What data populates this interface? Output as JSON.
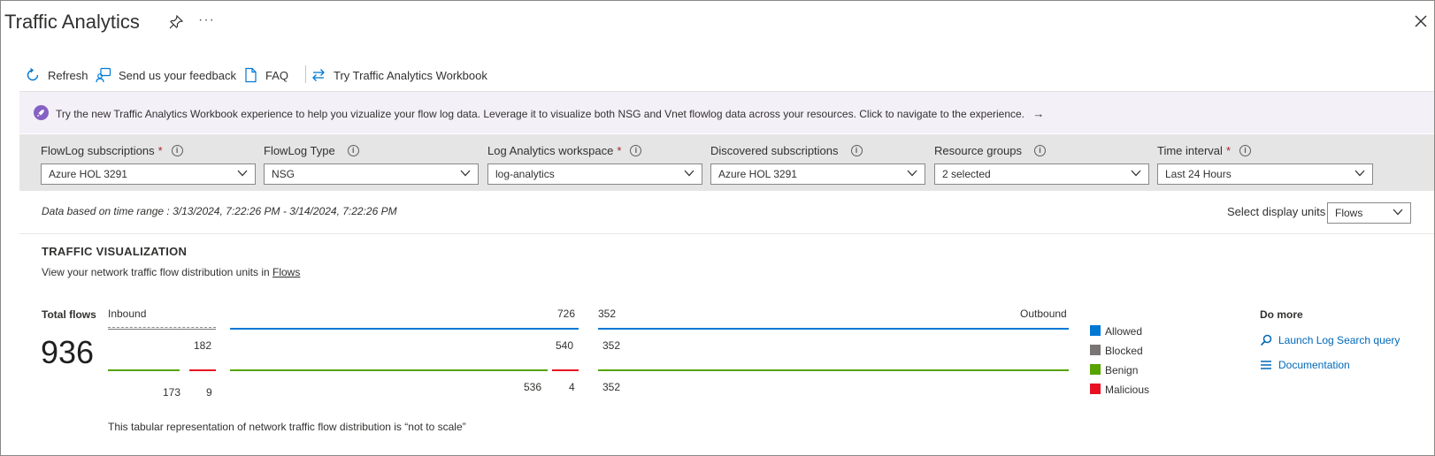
{
  "header": {
    "title": "Traffic Analytics",
    "more": "···"
  },
  "toolbar": {
    "refresh": "Refresh",
    "feedback": "Send us your feedback",
    "faq": "FAQ",
    "workbook": "Try Traffic Analytics Workbook"
  },
  "banner": {
    "text": "Try the new Traffic Analytics Workbook experience to help you vizualize your flow log data. Leverage it to visualize both NSG and Vnet flowlog data across your resources. Click to navigate to the experience.",
    "arrow": "→"
  },
  "filters": [
    {
      "label": "FlowLog subscriptions",
      "required": "*",
      "value": "Azure HOL 3291"
    },
    {
      "label": "FlowLog Type",
      "required": "",
      "value": "NSG"
    },
    {
      "label": "Log Analytics workspace",
      "required": "*",
      "value": "log-analytics"
    },
    {
      "label": "Discovered subscriptions",
      "required": "",
      "value": "Azure HOL 3291"
    },
    {
      "label": "Resource groups",
      "required": "",
      "value": "2 selected"
    },
    {
      "label": "Time interval",
      "required": "*",
      "value": "Last 24 Hours"
    }
  ],
  "time_range": "Data based on time range : 3/13/2024, 7:22:26 PM - 3/14/2024, 7:22:26 PM",
  "display_units": {
    "label": "Select display units",
    "value": "Flows"
  },
  "visualization": {
    "title": "TRAFFIC VISUALIZATION",
    "subtitle_prefix": "View your network traffic flow distribution units in ",
    "subtitle_link": "Flows",
    "total_label": "Total flows",
    "total": "936",
    "inbound_label": "Inbound",
    "outbound_label": "Outbound",
    "inbound_total": "726",
    "outbound_total": "352",
    "inbound_blocked": "182",
    "inbound_allowed": "540",
    "outbound_allowed": "352",
    "inbound_blocked_benign": "173",
    "inbound_blocked_malicious": "9",
    "inbound_allowed_benign": "536",
    "inbound_allowed_malicious": "4",
    "outbound_benign": "352",
    "note": "This tabular representation of network traffic flow distribution is “not to scale”"
  },
  "legend": [
    {
      "label": "Allowed",
      "color": "#0078d4"
    },
    {
      "label": "Blocked",
      "color": "#7a7574"
    },
    {
      "label": "Benign",
      "color": "#57a300"
    },
    {
      "label": "Malicious",
      "color": "#e81123"
    }
  ],
  "do_more": {
    "title": "Do more",
    "log_search": "Launch Log Search query",
    "documentation": "Documentation"
  }
}
